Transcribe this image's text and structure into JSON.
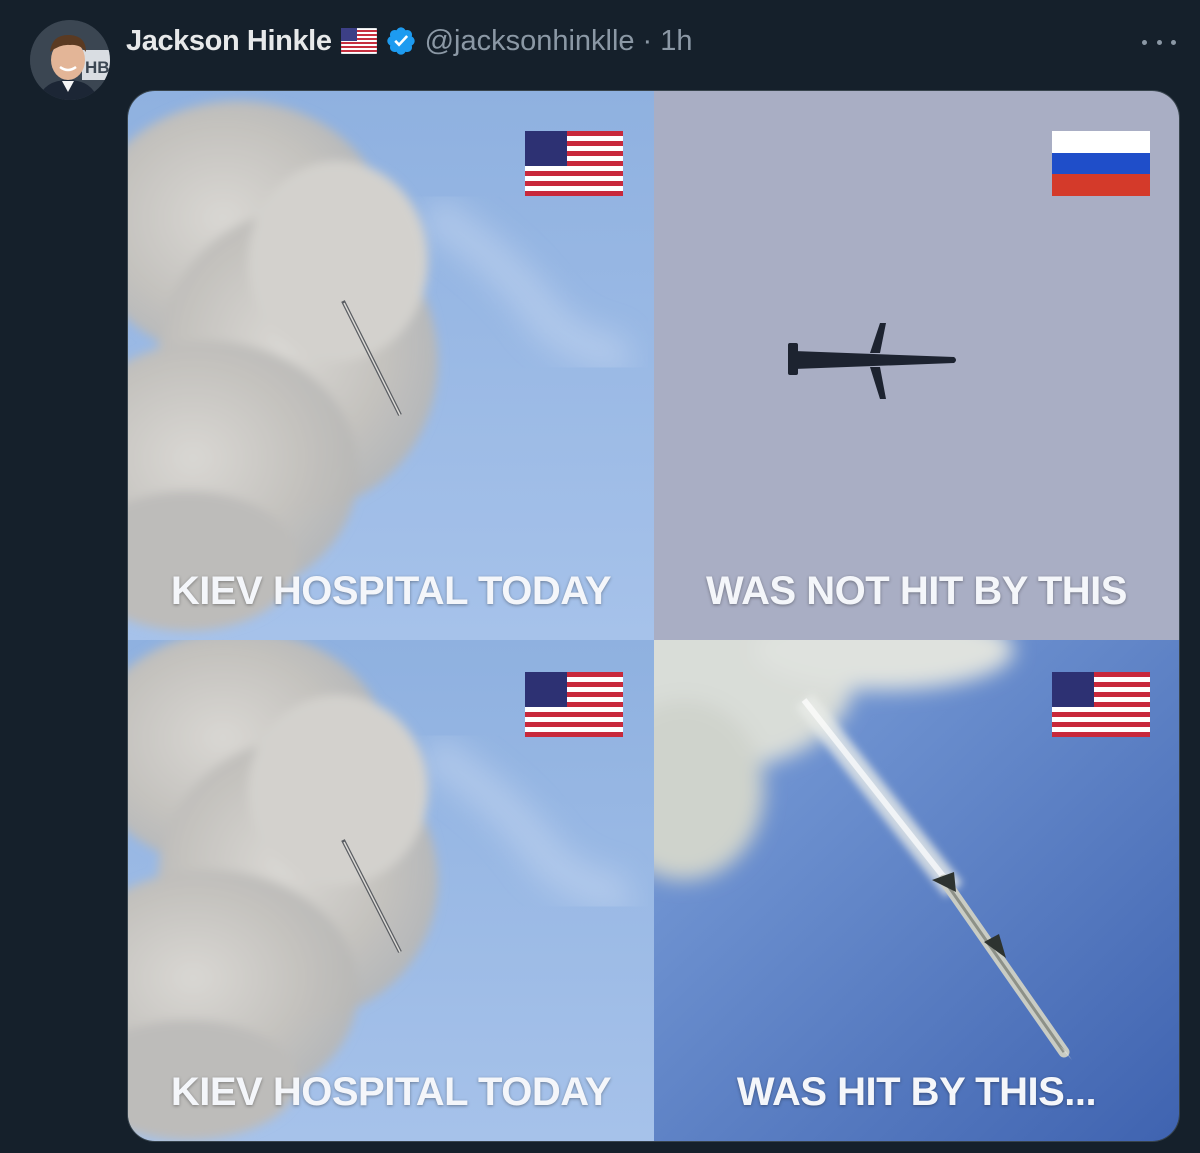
{
  "tweet": {
    "author_name": "Jackson Hinkle",
    "handle": "@jacksonhinklle",
    "separator": "·",
    "time": "1h",
    "icons": {
      "name_flag": "us-flag-icon",
      "verified": "verified-badge-icon",
      "more": "more-options-icon"
    },
    "colors": {
      "background": "#15202b",
      "name": "#e7e9ea",
      "secondary_text": "#8b98a5",
      "verified_badge": "#1d9bf0"
    }
  },
  "meme": {
    "panels": [
      {
        "caption": "KIEV HOSPITAL TODAY",
        "flag": "us-flag-icon",
        "scene": "smoke-cloud-with-missile"
      },
      {
        "caption": "WAS NOT HIT BY THIS",
        "flag": "russia-flag-icon",
        "scene": "cruise-missile-on-grey-sky"
      },
      {
        "caption": "KIEV HOSPITAL TODAY",
        "flag": "us-flag-icon",
        "scene": "smoke-cloud-with-missile"
      },
      {
        "caption": "WAS HIT BY THIS...",
        "flag": "us-flag-icon",
        "scene": "missile-with-smoke-trail-on-blue-sky"
      }
    ]
  }
}
